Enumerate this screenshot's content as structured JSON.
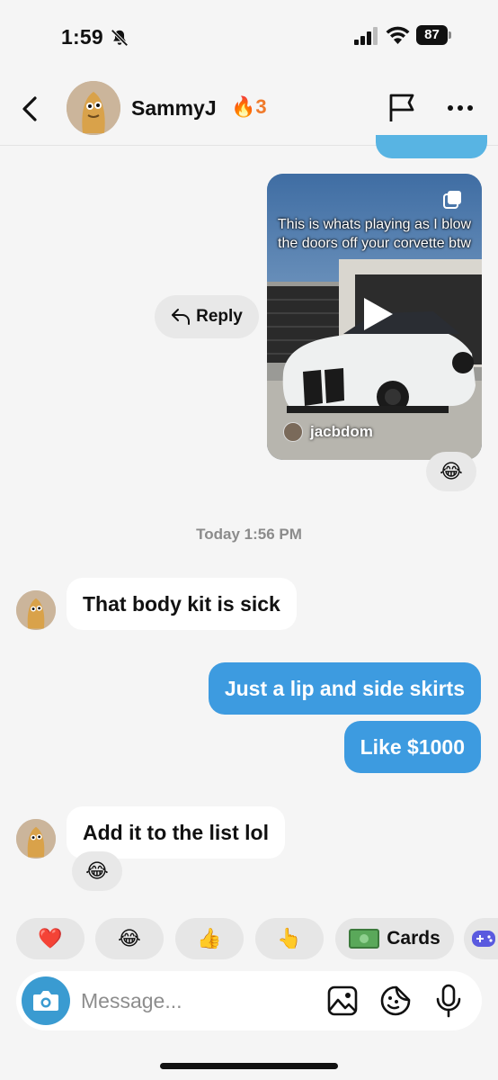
{
  "status_bar": {
    "time": "1:59",
    "battery": "87"
  },
  "header": {
    "contact_name": "SammyJ",
    "streak_count": "3",
    "streak_emoji": "🔥"
  },
  "shared_video": {
    "caption": "This is whats playing as I blow the doors off your corvette btw",
    "author": "jacbdom",
    "reaction": "😂"
  },
  "reply_label": "Reply",
  "timestamp": "Today 1:56 PM",
  "messages": [
    {
      "from": "them",
      "text": "That body kit is sick"
    },
    {
      "from": "me",
      "text": "Just a lip and side skirts"
    },
    {
      "from": "me",
      "text": "Like $1000"
    },
    {
      "from": "them",
      "text": "Add it to the list lol",
      "reaction": "😂"
    }
  ],
  "quick_reactions": [
    "❤️",
    "😂",
    "👍",
    "👆"
  ],
  "cards_label": "Cards",
  "composer": {
    "placeholder": "Message..."
  },
  "colors": {
    "outgoing": "#3d9be0",
    "streak": "#f07a2b",
    "camera": "#3a9bd1"
  }
}
